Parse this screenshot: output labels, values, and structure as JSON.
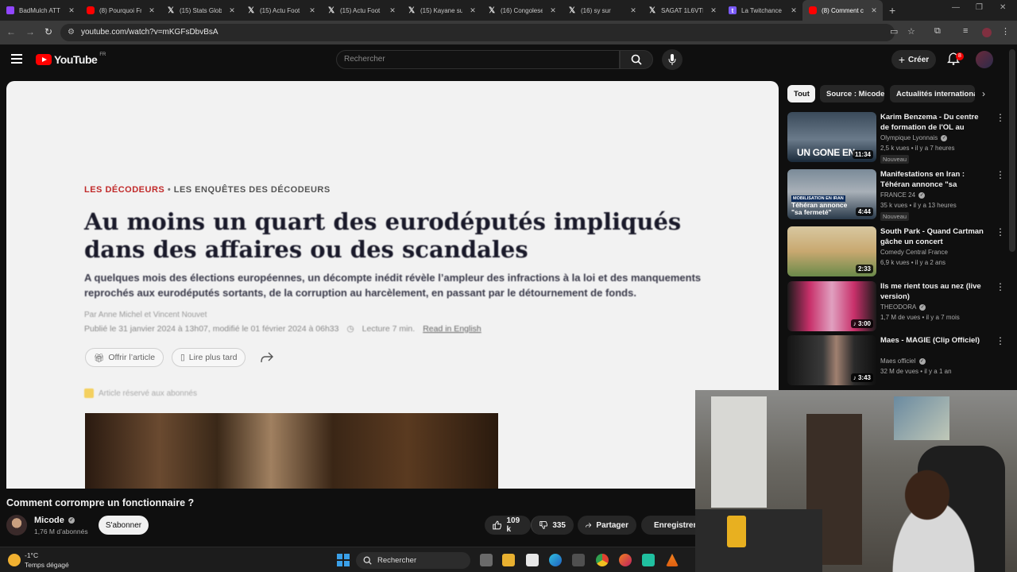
{
  "browser": {
    "tabs": [
      {
        "title": "BadMulch ATT",
        "favicon": "twitch",
        "active": false
      },
      {
        "title": "(8) Pourquoi Fr",
        "favicon": "youtube",
        "active": false
      },
      {
        "title": "(15) Stats Glob",
        "favicon": "x",
        "active": false
      },
      {
        "title": "(15) Actu Foot",
        "favicon": "x",
        "active": false
      },
      {
        "title": "(15) Actu Foot",
        "favicon": "x",
        "active": false
      },
      {
        "title": "(15) Kayane su",
        "favicon": "x",
        "active": false
      },
      {
        "title": "(16) Congolese",
        "favicon": "x",
        "active": false
      },
      {
        "title": "(16) sy sur",
        "favicon": "x",
        "active": false
      },
      {
        "title": "SAGAT 1L6VTE",
        "favicon": "x",
        "active": false
      },
      {
        "title": "La Twitchance",
        "favicon": "t",
        "active": false
      },
      {
        "title": "(8) Comment c",
        "favicon": "youtube",
        "active": true
      }
    ],
    "url": "youtube.com/watch?v=mKGFsDbvBsA"
  },
  "youtube": {
    "logo_text": "YouTube",
    "country": "FR",
    "search_placeholder": "Rechercher",
    "create_label": "Créer",
    "notif_count": "8"
  },
  "article": {
    "rubric": "LES DÉCODEURS",
    "rubric_sep": "•",
    "rubric_sub": "LES ENQUÊTES DES DÉCODEURS",
    "headline": "Au moins un quart des eurodéputés impliqués dans des affaires ou des scandales",
    "standfirst": "A quelques mois des élections européennes, un décompte inédit révèle l’ampleur des infractions à la loi et des manquements reprochés aux eurodéputés sortants, de la corruption au harcèlement, en passant par le détournement de fonds.",
    "byline": "Par Anne Michel et Vincent Nouvet",
    "published": "Publié le 31 janvier 2024 à 13h07, modifié le 01 février 2024 à 06h33",
    "reading": "Lecture 7 min.",
    "read_english": "Read in English",
    "offer_label": "Offrir l’article",
    "later_label": "Lire plus tard",
    "reserved": "Article réservé aux abonnés"
  },
  "video": {
    "title": "Comment corrompre un fonctionnaire ?",
    "channel": "Micode",
    "subscribers": "1,76 M d’abonnés",
    "subscribe_label": "S'abonner",
    "likes": "109 k",
    "dislikes": "335",
    "share_label": "Partager",
    "save_label": "Enregistrer"
  },
  "chips": [
    {
      "label": "Tout",
      "active": true
    },
    {
      "label": "Source : Micode",
      "active": false
    },
    {
      "label": "Actualités internationales",
      "active": false
    }
  ],
  "recommendations": [
    {
      "title": "Karim Benzema - Du centre de formation de l'OL au Ballon d'...",
      "channel": "Olympique Lyonnais",
      "verified": true,
      "meta": "2,5 k vues • il y a 7 heures",
      "badge": "Nouveau",
      "duration": "11:34",
      "thumb_text": "UN GONE EN"
    },
    {
      "title": "Manifestations en Iran : Téhéran annonce \"sa fermeté\" en cas d...",
      "channel": "FRANCE 24",
      "verified": true,
      "meta": "35 k vues • il y a 13 heures",
      "badge": "Nouveau",
      "duration": "4:44",
      "thumb_text": "Téhéran annonce \"sa fermeté\"",
      "thumb_tag": "MOBILISATION EN IRAN"
    },
    {
      "title": "South Park - Quand Cartman gâche un concert",
      "channel": "Comedy Central France",
      "verified": false,
      "meta": "6,9 k vues • il y a 2 ans",
      "badge": "",
      "duration": "2:33"
    },
    {
      "title": "Ils me rient tous au nez (live version)",
      "channel": "THEODORA",
      "verified": true,
      "meta": "1,7 M de vues • il y a 7 mois",
      "badge": "",
      "duration": "3:00"
    },
    {
      "title": "Maes - MAGIE (Clip Officiel)",
      "channel": "Maes officiel",
      "verified": true,
      "meta": "32 M de vues • il y a 1 an",
      "badge": "",
      "duration": "3:43"
    }
  ],
  "taskbar": {
    "temperature": "-1°C",
    "weather": "Temps dégagé",
    "search_label": "Rechercher"
  }
}
